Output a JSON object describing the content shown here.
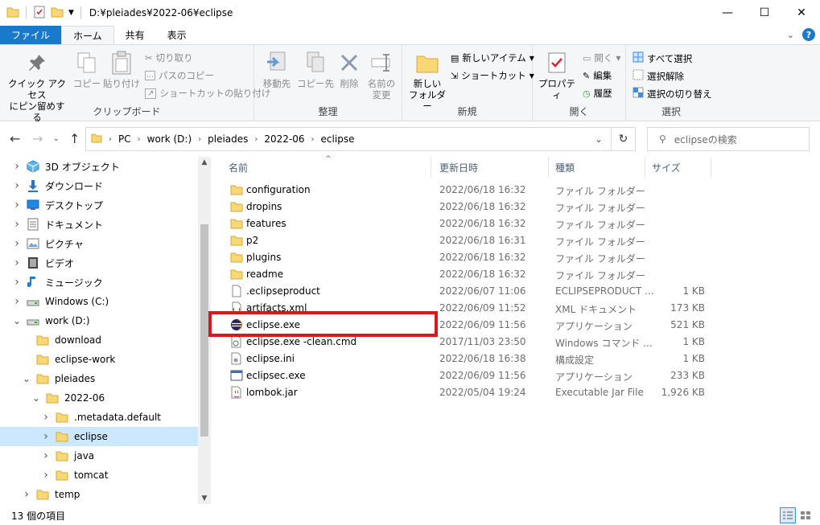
{
  "window": {
    "title": "D:¥pleiades¥2022-06¥eclipse"
  },
  "ribbon_tabs": [
    "ファイル",
    "ホーム",
    "共有",
    "表示"
  ],
  "ribbon": {
    "clipboard": {
      "label": "クリップボード",
      "pin": "クイック アクセス\nにピン留めする",
      "copy": "コピー",
      "paste": "貼り付け",
      "cut": "切り取り",
      "copy_path": "パスのコピー",
      "paste_shortcut": "ショートカットの貼り付け"
    },
    "organize": {
      "label": "整理",
      "move_to": "移動先",
      "copy_to": "コピー先",
      "delete": "削除",
      "rename": "名前の\n変更"
    },
    "new": {
      "label": "新規",
      "new_folder": "新しい\nフォルダー",
      "new_item": "新しいアイテム",
      "easy_access": "ショートカット"
    },
    "open": {
      "label": "開く",
      "properties": "プロパティ",
      "open": "開く",
      "edit": "編集",
      "history": "履歴"
    },
    "select": {
      "label": "選択",
      "select_all": "すべて選択",
      "select_none": "選択解除",
      "invert": "選択の切り替え"
    }
  },
  "address": {
    "crumbs": [
      "PC",
      "work (D:)",
      "pleiades",
      "2022-06",
      "eclipse"
    ],
    "search_placeholder": "eclipseの検索"
  },
  "nav_tree": [
    {
      "label": "3D オブジェクト",
      "icon": "3d-objects-icon",
      "level": 0,
      "expander": "collapsed"
    },
    {
      "label": "ダウンロード",
      "icon": "download-icon",
      "level": 0,
      "expander": "collapsed"
    },
    {
      "label": "デスクトップ",
      "icon": "desktop-icon",
      "level": 0,
      "expander": "collapsed"
    },
    {
      "label": "ドキュメント",
      "icon": "documents-icon",
      "level": 0,
      "expander": "collapsed"
    },
    {
      "label": "ピクチャ",
      "icon": "pictures-icon",
      "level": 0,
      "expander": "collapsed"
    },
    {
      "label": "ビデオ",
      "icon": "videos-icon",
      "level": 0,
      "expander": "collapsed"
    },
    {
      "label": "ミュージック",
      "icon": "music-icon",
      "level": 0,
      "expander": "collapsed"
    },
    {
      "label": "Windows (C:)",
      "icon": "drive-icon",
      "level": 0,
      "expander": "collapsed"
    },
    {
      "label": "work (D:)",
      "icon": "drive-icon",
      "level": 0,
      "expander": "expanded"
    },
    {
      "label": "download",
      "icon": "folder-icon",
      "level": 1,
      "expander": "none"
    },
    {
      "label": "eclipse-work",
      "icon": "folder-icon",
      "level": 1,
      "expander": "none"
    },
    {
      "label": "pleiades",
      "icon": "folder-icon",
      "level": 1,
      "expander": "expanded"
    },
    {
      "label": "2022-06",
      "icon": "folder-icon",
      "level": 2,
      "expander": "expanded"
    },
    {
      "label": ".metadata.default",
      "icon": "folder-icon",
      "level": 3,
      "expander": "collapsed"
    },
    {
      "label": "eclipse",
      "icon": "folder-icon",
      "level": 3,
      "expander": "collapsed",
      "selected": true
    },
    {
      "label": "java",
      "icon": "folder-icon",
      "level": 3,
      "expander": "collapsed"
    },
    {
      "label": "tomcat",
      "icon": "folder-icon",
      "level": 3,
      "expander": "collapsed"
    },
    {
      "label": "temp",
      "icon": "folder-icon",
      "level": 1,
      "expander": "collapsed"
    }
  ],
  "columns": {
    "name": "名前",
    "date": "更新日時",
    "type": "種類",
    "size": "サイズ"
  },
  "files": [
    {
      "name": "configuration",
      "date": "2022/06/18 16:32",
      "type": "ファイル フォルダー",
      "size": "",
      "icon": "folder-icon"
    },
    {
      "name": "dropins",
      "date": "2022/06/18 16:32",
      "type": "ファイル フォルダー",
      "size": "",
      "icon": "folder-icon"
    },
    {
      "name": "features",
      "date": "2022/06/18 16:32",
      "type": "ファイル フォルダー",
      "size": "",
      "icon": "folder-icon"
    },
    {
      "name": "p2",
      "date": "2022/06/18 16:31",
      "type": "ファイル フォルダー",
      "size": "",
      "icon": "folder-icon"
    },
    {
      "name": "plugins",
      "date": "2022/06/18 16:32",
      "type": "ファイル フォルダー",
      "size": "",
      "icon": "folder-icon"
    },
    {
      "name": "readme",
      "date": "2022/06/18 16:32",
      "type": "ファイル フォルダー",
      "size": "",
      "icon": "folder-icon"
    },
    {
      "name": ".eclipseproduct",
      "date": "2022/06/07 11:06",
      "type": "ECLIPSEPRODUCT ...",
      "size": "1 KB",
      "icon": "blank-file-icon"
    },
    {
      "name": "artifacts.xml",
      "date": "2022/06/09 11:52",
      "type": "XML ドキュメント",
      "size": "173 KB",
      "icon": "xml-file-icon"
    },
    {
      "name": "eclipse.exe",
      "date": "2022/06/09 11:56",
      "type": "アプリケーション",
      "size": "521 KB",
      "icon": "eclipse-icon"
    },
    {
      "name": "eclipse.exe -clean.cmd",
      "date": "2017/11/03 23:50",
      "type": "Windows コマンド ...",
      "size": "1 KB",
      "icon": "cmd-file-icon"
    },
    {
      "name": "eclipse.ini",
      "date": "2022/06/18 16:38",
      "type": "構成設定",
      "size": "1 KB",
      "icon": "settings-file-icon"
    },
    {
      "name": "eclipsec.exe",
      "date": "2022/06/09 11:56",
      "type": "アプリケーション",
      "size": "233 KB",
      "icon": "app-window-icon"
    },
    {
      "name": "lombok.jar",
      "date": "2022/05/04 19:24",
      "type": "Executable Jar File",
      "size": "1,926 KB",
      "icon": "jar-file-icon"
    }
  ],
  "status": {
    "item_count": "13 個の項目"
  },
  "colors": {
    "file_tab": "#1979ca",
    "selected": "#cce8ff",
    "highlight": "#e0141e",
    "folder": "#f8d775"
  }
}
